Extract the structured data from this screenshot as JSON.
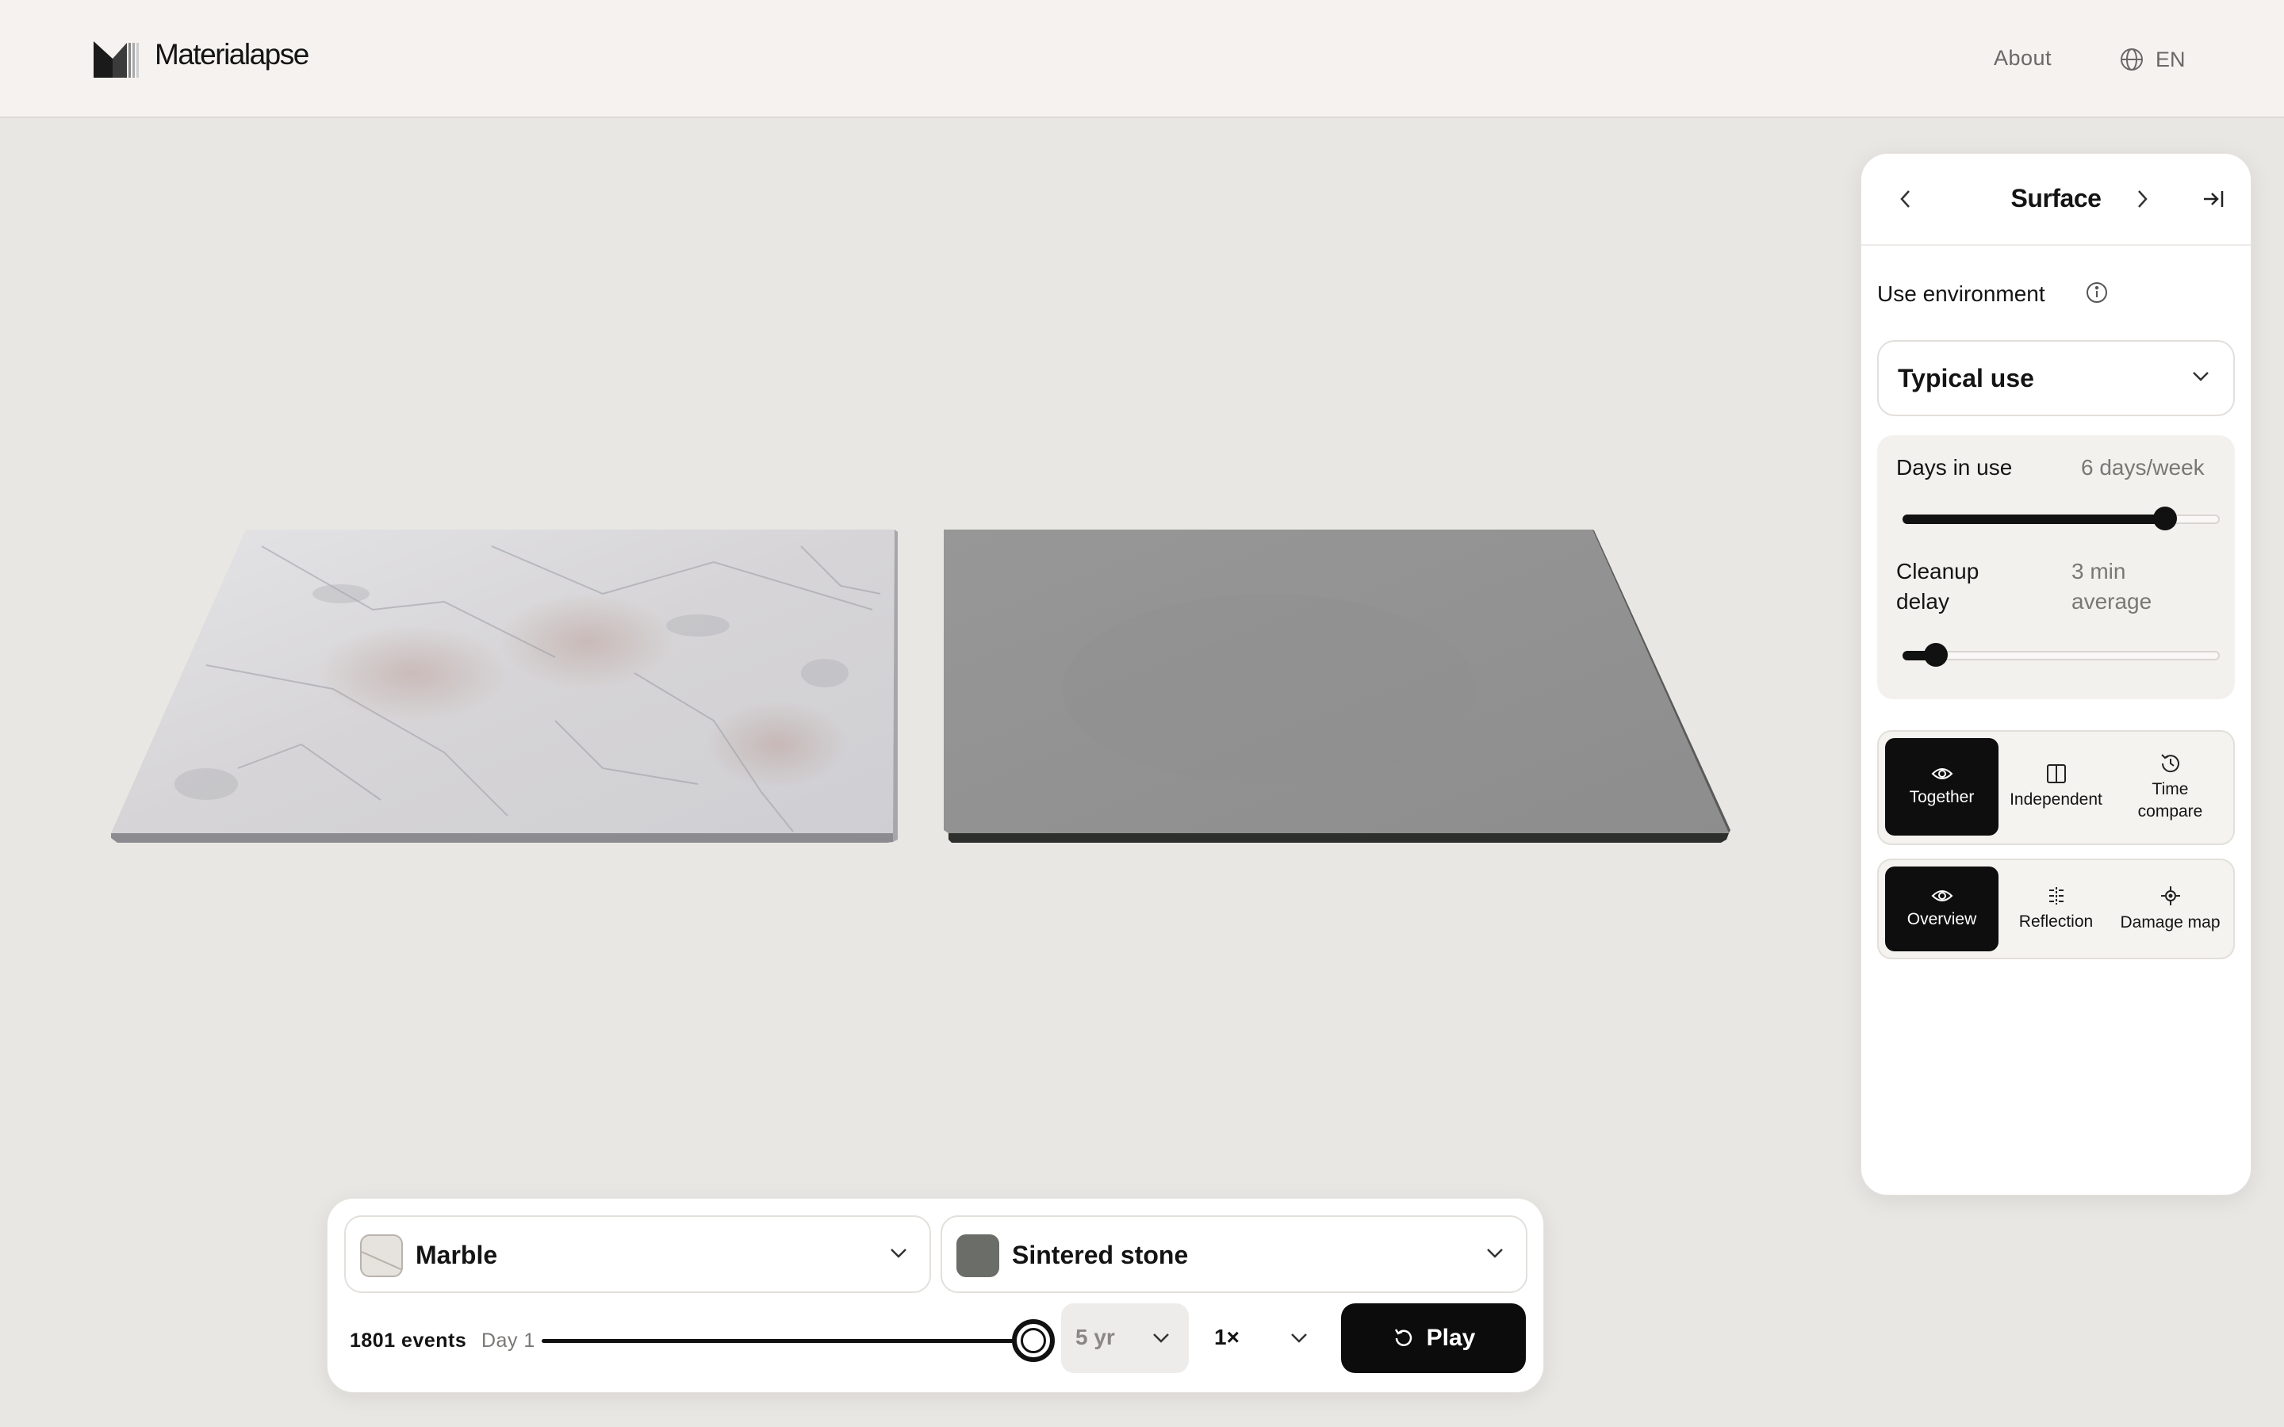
{
  "header": {
    "brand": "Materialapse",
    "nav_about": "About",
    "language": "EN"
  },
  "panel": {
    "title": "Surface",
    "environment_label": "Use environment",
    "environment_value": "Typical use",
    "days": {
      "label": "Days in use",
      "value": "6 days/week",
      "level": 0.83
    },
    "cleanup": {
      "label_line1": "Cleanup",
      "label_line2": "delay",
      "value_line1": "3 min",
      "value_line2": "average",
      "level": 0.1
    },
    "view_modes": [
      {
        "label": "Together",
        "icon": "eye-icon",
        "active": true
      },
      {
        "label": "Independent",
        "icon": "split-columns-icon",
        "active": false
      },
      {
        "label_line1": "Time",
        "label_line2": "compare",
        "icon": "history-icon",
        "active": false
      }
    ],
    "render_modes": [
      {
        "label": "Overview",
        "icon": "eye-icon",
        "active": true
      },
      {
        "label": "Reflection",
        "icon": "reflection-icon",
        "active": false
      },
      {
        "label": "Damage map",
        "icon": "crosshair-icon",
        "active": false
      }
    ]
  },
  "bottom_bar": {
    "material_a": "Marble",
    "material_b": "Sintered stone",
    "events": "1801 events",
    "day": "Day 1",
    "timeline_progress": 1.0,
    "duration": "5 yr",
    "speed": "1×",
    "play_label": "Play"
  },
  "colors": {
    "accent": "#0e0e0e",
    "background": "#e9e7e3",
    "marble": "#d9d9db",
    "sintered_stone": "#929292"
  }
}
